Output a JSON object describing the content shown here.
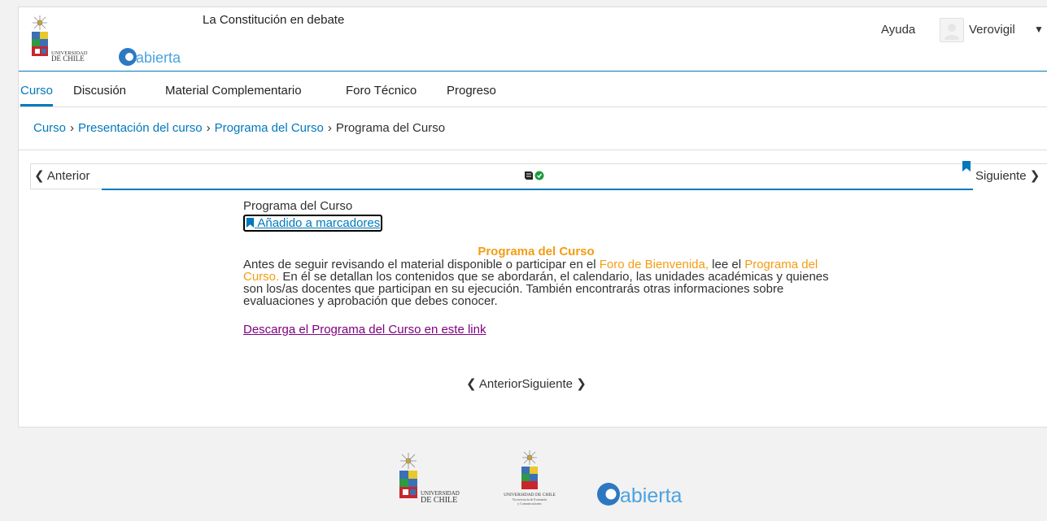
{
  "header": {
    "logo_text_line1": "UNIVERSIDAD",
    "logo_text_line2": "DE CHILE",
    "abierta_logo_text": "abierta",
    "course_title": "La Constitución en debate",
    "help_label": "Ayuda",
    "username": "Verovigil"
  },
  "tabs": [
    {
      "label": "Curso",
      "active": true
    },
    {
      "label": "Discusión"
    },
    {
      "label": "Material Complementario"
    },
    {
      "label": "Foro Técnico"
    },
    {
      "label": "Progreso"
    }
  ],
  "breadcrumb": {
    "items": [
      "Curso",
      "Presentación del curso",
      "Programa del Curso"
    ],
    "current": "Programa del Curso",
    "separator": "›"
  },
  "sequence_nav": {
    "prev_label": "Anterior",
    "next_label": "Siguiente"
  },
  "content": {
    "unit_title": "Programa del Curso",
    "bookmark_label": "Añadido a marcadores",
    "heading": "Programa del Curso",
    "p_part1": "Antes de seguir revisando el material disponible o participar en el ",
    "p_link1": "Foro de Bienvenida, ",
    "p_part2": " lee el ",
    "p_link2": "Programa del Curso.",
    "p_part3": " En él se detallan los contenidos que se abordarán, el calendario, las unidades académicas y quienes son los/as docentes que participan en su ejecución. También encontrarás otras informaciones sobre evaluaciones y aprobación que debes conocer.",
    "download_link": "Descarga el Programa del Curso en este link"
  },
  "bottom_nav": {
    "prev_label": "Anterior",
    "next_label": "Siguiente"
  },
  "footer": {
    "uchile_line1": "UNIVERSIDAD",
    "uchile_line2": "DE CHILE",
    "vex_line1": "UNIVERSIDAD DE CHILE",
    "vex_line2": "Vicerrectoría de Extensión",
    "vex_line3": "y Comunicaciones",
    "abierta_text": "abierta"
  },
  "colors": {
    "brand_blue": "#0079bc",
    "highlight_orange": "#f39c12",
    "visited_link": "#800080"
  }
}
